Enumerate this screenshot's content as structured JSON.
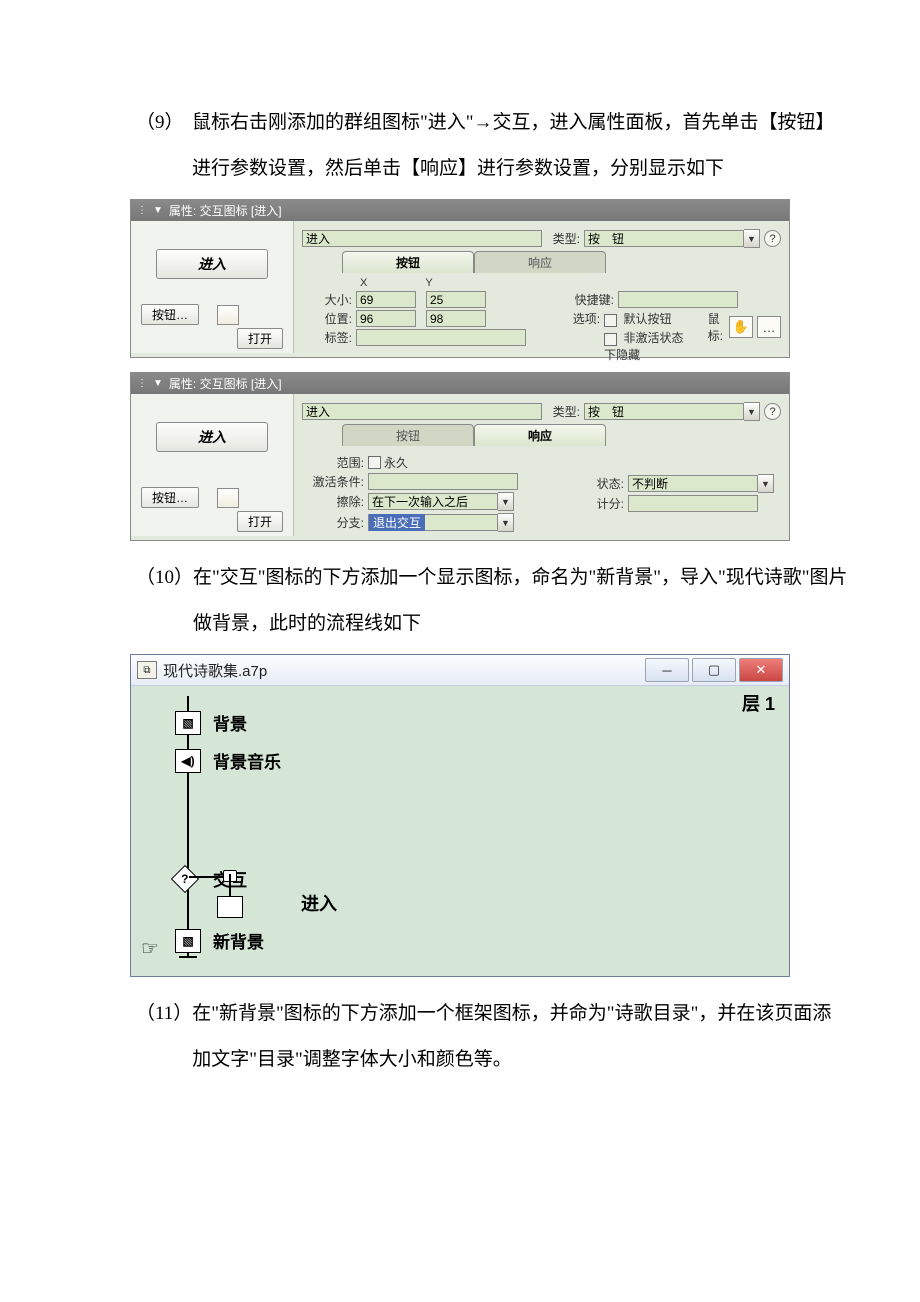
{
  "step9": {
    "num": "（9）",
    "text": "鼠标右击刚添加的群组图标\"进入\"→交互，进入属性面板，首先单击【按钮】进行参数设置，然后单击【响应】进行参数设置，分别显示如下"
  },
  "panel1": {
    "title": "属性: 交互图标 [进入]",
    "left": {
      "enter": "进入",
      "button": "按钮…",
      "open": "打开"
    },
    "right": {
      "name": "进入",
      "type_label": "类型:",
      "type_value": "按　钮",
      "tab_button": "按钮",
      "tab_response": "响应",
      "col_x": "X",
      "col_y": "Y",
      "size_label": "大小:",
      "size_x": "69",
      "size_y": "25",
      "pos_label": "位置:",
      "pos_x": "96",
      "pos_y": "98",
      "tag_label": "标签:",
      "hotkey_label": "快捷键:",
      "option_label": "选项:",
      "chk_default": "默认按钮",
      "chk_hide": "非激活状态下隐藏",
      "mouse_label": "鼠标:"
    }
  },
  "panel2": {
    "title": "属性: 交互图标 [进入]",
    "left": {
      "enter": "进入",
      "button": "按钮…",
      "open": "打开"
    },
    "right": {
      "name": "进入",
      "type_label": "类型:",
      "type_value": "按　钮",
      "tab_button": "按钮",
      "tab_response": "响应",
      "scope_label": "范围:",
      "chk_perm": "永久",
      "cond_label": "激活条件:",
      "cond_value": "",
      "erase_label": "擦除:",
      "erase_value": "在下一次输入之后",
      "branch_label": "分支:",
      "branch_value": "退出交互",
      "status_label": "状态:",
      "status_value": "不判断",
      "score_label": "计分:",
      "score_value": ""
    }
  },
  "step10": {
    "num": "（10）",
    "text": "在\"交互\"图标的下方添加一个显示图标，命名为\"新背景\"，导入\"现代诗歌\"图片做背景，此时的流程线如下"
  },
  "flow": {
    "title": "现代诗歌集.a7p",
    "layer": "层 1",
    "nodes": {
      "bg": "背景",
      "music": "背景音乐",
      "interact": "交互",
      "enter": "进入",
      "newbg": "新背景"
    }
  },
  "step11": {
    "num": "（11）",
    "text": "在\"新背景\"图标的下方添加一个框架图标，并命为\"诗歌目录\"，并在该页面添加文字\"目录\"调整字体大小和颜色等。"
  }
}
